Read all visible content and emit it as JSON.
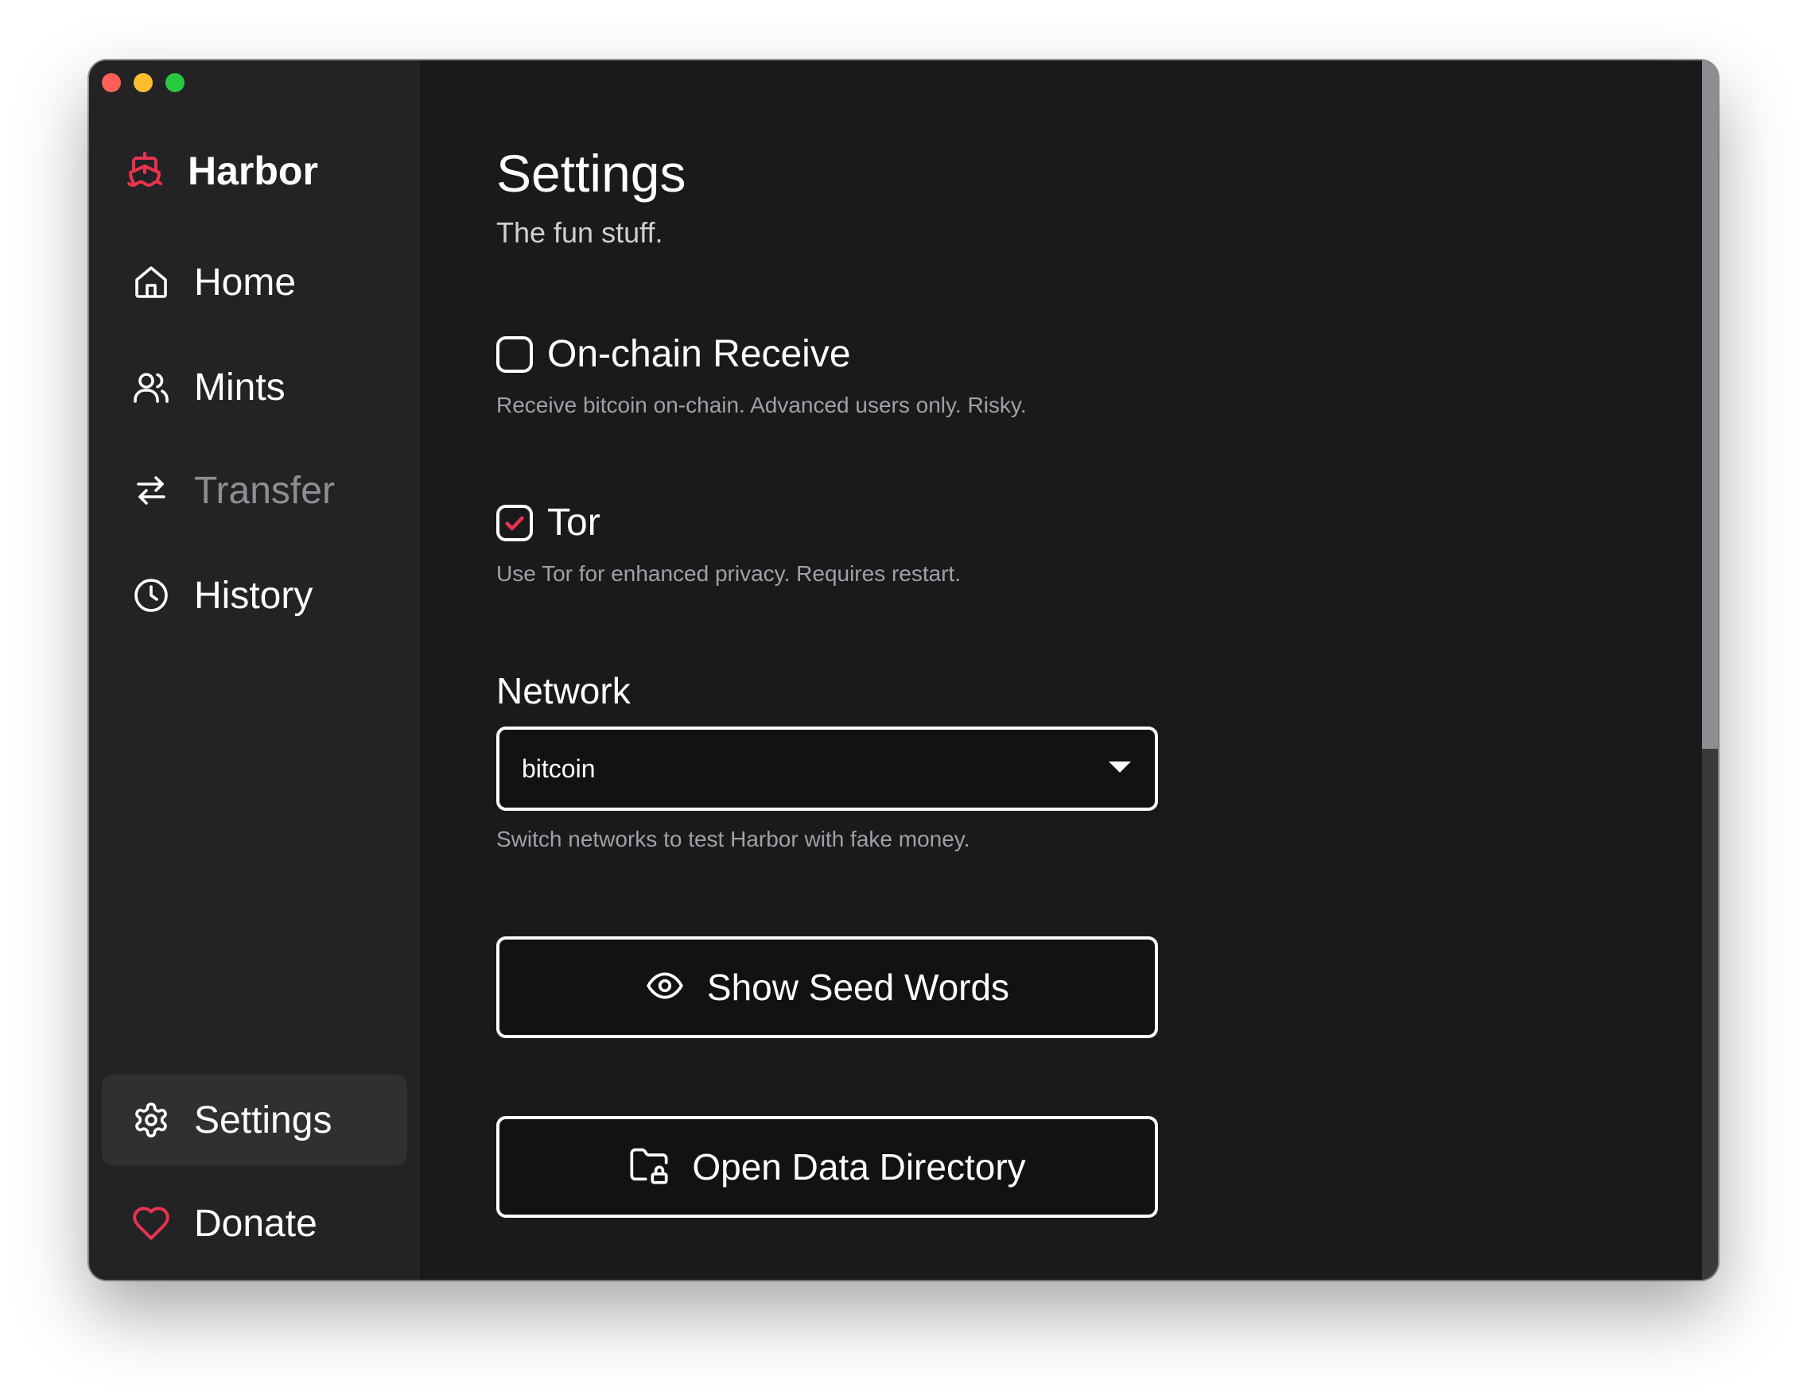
{
  "window": {
    "traffic_lights": [
      {
        "name": "close",
        "color": "#ff5f57"
      },
      {
        "name": "minimize",
        "color": "#febc2e"
      },
      {
        "name": "zoom",
        "color": "#28c840"
      }
    ]
  },
  "sidebar": {
    "brand": {
      "name": "Harbor",
      "icon": "ship-icon",
      "color": "#e8344f"
    },
    "items": [
      {
        "label": "Home",
        "icon": "home-icon",
        "state": "normal"
      },
      {
        "label": "Mints",
        "icon": "users-icon",
        "state": "normal"
      },
      {
        "label": "Transfer",
        "icon": "arrows-left-right-icon",
        "state": "disabled"
      },
      {
        "label": "History",
        "icon": "clock-icon",
        "state": "normal"
      },
      {
        "label": "Settings",
        "icon": "gear-icon",
        "state": "active"
      },
      {
        "label": "Donate",
        "icon": "heart-icon",
        "state": "normal"
      }
    ]
  },
  "main": {
    "title": "Settings",
    "subtitle": "The fun stuff.",
    "onchain": {
      "label": "On-chain Receive",
      "checked": false,
      "hint": "Receive bitcoin on-chain. Advanced users only. Risky."
    },
    "tor": {
      "label": "Tor",
      "checked": true,
      "hint": "Use Tor for enhanced privacy. Requires restart."
    },
    "network": {
      "label": "Network",
      "selected": "bitcoin",
      "hint": "Switch networks to test Harbor with fake money."
    },
    "seed_button": {
      "label": "Show Seed Words",
      "icon": "eye-icon"
    },
    "data_dir_button": {
      "label": "Open Data Directory",
      "icon": "folder-lock-icon"
    }
  },
  "colors": {
    "accent": "#e8344f",
    "background": "#1a1a1c",
    "sidebar": "#232326",
    "active_item": "#303033"
  }
}
